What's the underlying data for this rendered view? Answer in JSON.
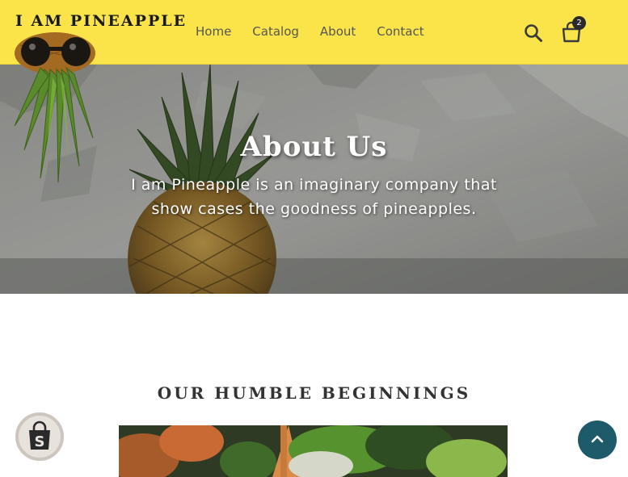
{
  "header": {
    "brand": "I AM PINEAPPLE",
    "nav": [
      "Home",
      "Catalog",
      "About",
      "Contact"
    ],
    "search_icon": "search-icon",
    "cart_icon": "cart-icon",
    "cart_count": "2",
    "bg_color": "#fbe44a"
  },
  "hero": {
    "title": "About Us",
    "text": "I am Pineapple is an imaginary company that show cases the goodness of pineapples."
  },
  "section": {
    "title": "OUR HUMBLE BEGINNINGS"
  },
  "floating": {
    "shopify_icon": "shopify-bag-icon",
    "scroll_top_icon": "chevron-up-icon",
    "scroll_top_color": "#1d5a6a"
  }
}
